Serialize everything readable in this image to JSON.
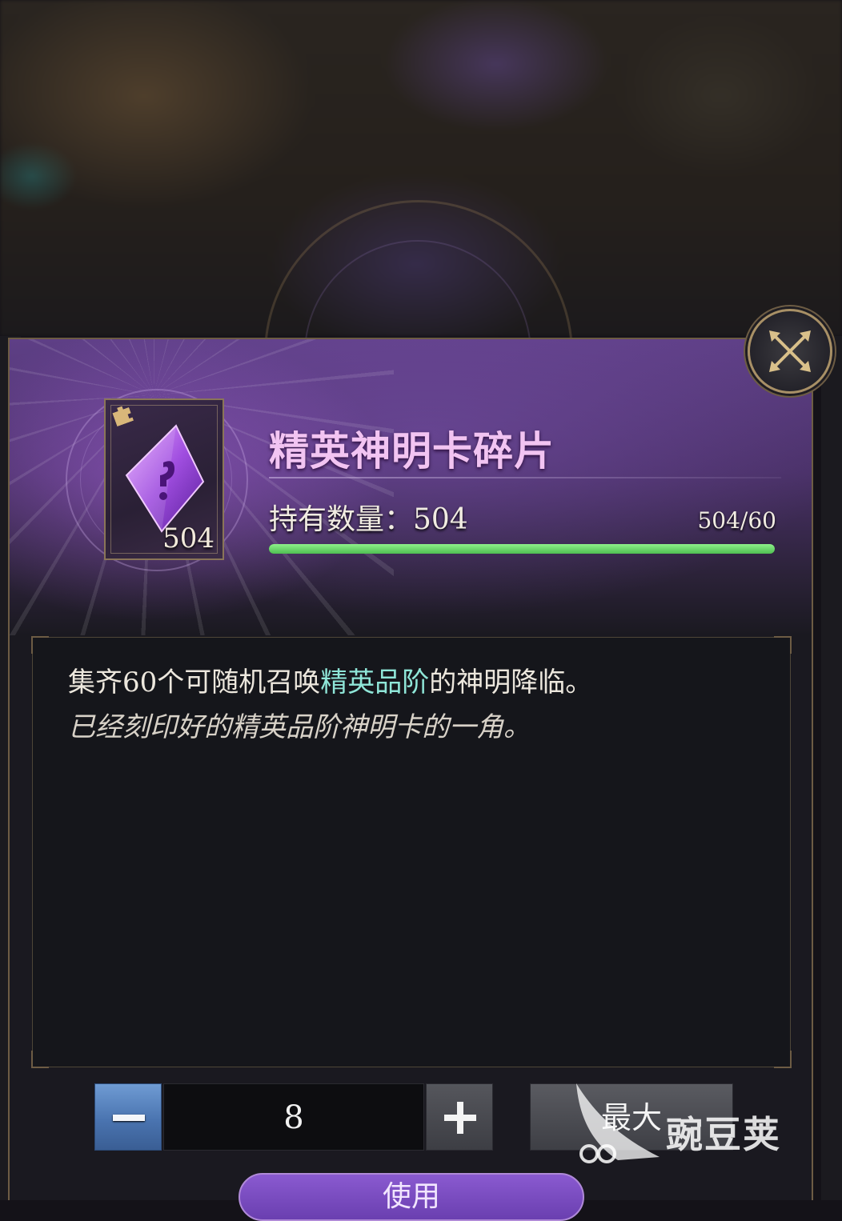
{
  "item": {
    "name": "精英神明卡碎片",
    "card_count": "504",
    "owned_label": "持有数量：504",
    "progress_text": "504/60",
    "progress_fraction": 1.0
  },
  "description": {
    "line1_prefix": "集齐60个可随机召唤",
    "line1_highlight": "精英品阶",
    "line1_suffix": "的神明降临。",
    "line2": "已经刻印好的精英品阶神明卡的一角。"
  },
  "quantity": {
    "minus_label": "−",
    "value": "8",
    "plus_label": "+",
    "max_label": "最大"
  },
  "use_button": {
    "label": "使用"
  },
  "watermark": {
    "text": "豌豆荚"
  },
  "colors": {
    "title": "#f2c4f2",
    "highlight": "#8fe6d8",
    "progress": "#5ccf5c",
    "minus_button": "#4a74b0"
  },
  "icons": {
    "close": "close-icon",
    "item": "crystal-icon",
    "corner": "puzzle-icon"
  }
}
